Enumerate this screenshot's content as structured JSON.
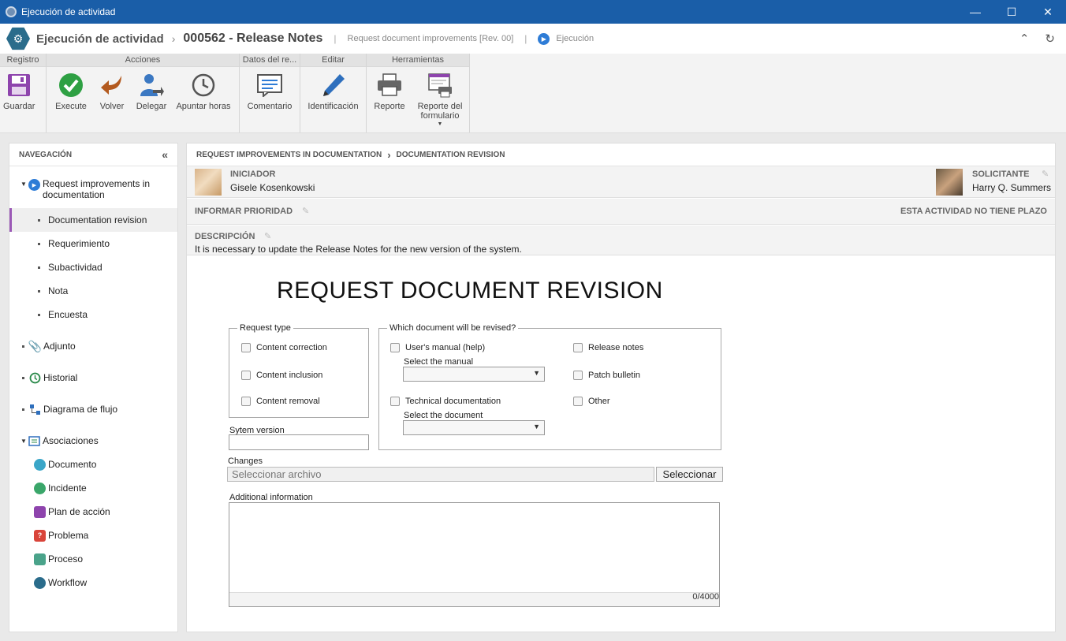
{
  "window": {
    "title": "Ejecución de actividad"
  },
  "header": {
    "title": "Ejecución de actividad",
    "code": "000562 - Release Notes",
    "process": "Request document improvements [Rev. 00]",
    "status": "Ejecución"
  },
  "ribbon": {
    "groups": {
      "registro": "Registro",
      "acciones": "Acciones",
      "datos": "Datos del re...",
      "editar": "Editar",
      "herramientas": "Herramientas"
    },
    "buttons": {
      "guardar": "Guardar",
      "execute": "Execute",
      "volver": "Volver",
      "delegar": "Delegar",
      "apuntar": "Apuntar horas",
      "comentario": "Comentario",
      "identificacion": "Identificación",
      "reporte": "Reporte",
      "reporte_form_1": "Reporte del",
      "reporte_form_2": "formulario"
    }
  },
  "nav": {
    "heading": "NAVEGACIÓN",
    "root": "Request improvements in documentation",
    "children": [
      "Documentation revision",
      "Requerimiento",
      "Subactividad",
      "Nota",
      "Encuesta"
    ],
    "adjunto": "Adjunto",
    "historial": "Historial",
    "diagrama": "Diagrama de flujo",
    "asociaciones": "Asociaciones",
    "assoc_items": [
      "Documento",
      "Incidente",
      "Plan de acción",
      "Problema",
      "Proceso",
      "Workflow"
    ]
  },
  "main": {
    "breadcrumb_1": "REQUEST IMPROVEMENTS IN DOCUMENTATION",
    "breadcrumb_2": "DOCUMENTATION REVISION",
    "iniciador_label": "INICIADOR",
    "iniciador_name": "Gisele Kosenkowski",
    "solicitante_label": "SOLICITANTE",
    "solicitante_name": "Harry Q. Summers",
    "prioridad_label": "INFORMAR PRIORIDAD",
    "plazo": "ESTA ACTIVIDAD NO TIENE PLAZO",
    "descripcion_label": "DESCRIPCIÓN",
    "descripcion": "It is necessary to update the Release Notes for the new version of the system."
  },
  "form": {
    "title": "REQUEST DOCUMENT REVISION",
    "request_type_legend": "Request type",
    "request_types": [
      "Content correction",
      "Content inclusion",
      "Content removal"
    ],
    "which_doc_legend": "Which document will be revised?",
    "users_manual": "User's manual (help)",
    "select_manual": "Select the manual",
    "technical_doc": "Technical documentation",
    "select_document": "Select the document",
    "release_notes": "Release notes",
    "patch_bulletin": "Patch bulletin",
    "other": "Other",
    "system_version": "Sytem version",
    "changes": "Changes",
    "file_placeholder": "Seleccionar archivo",
    "select_button": "Seleccionar",
    "additional_info": "Additional information",
    "counter": "0/4000"
  }
}
